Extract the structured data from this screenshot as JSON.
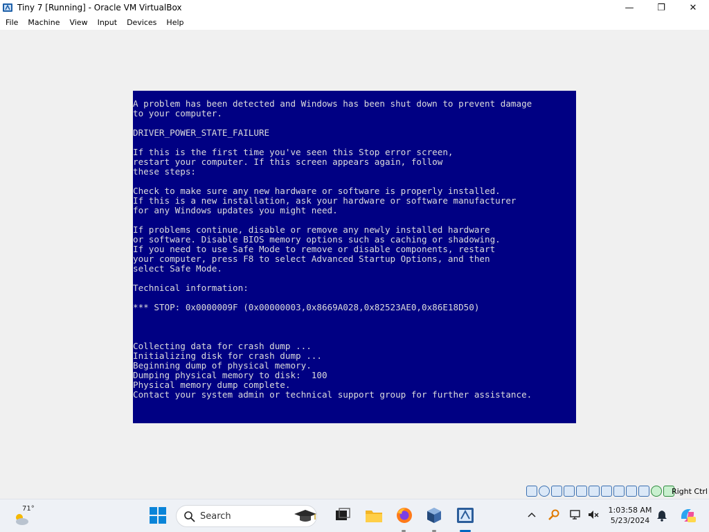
{
  "window": {
    "title": "Tiny 7 [Running] - Oracle VM VirtualBox",
    "minimize_glyph": "—",
    "maximize_glyph": "❐",
    "close_glyph": "✕"
  },
  "menu": {
    "items": [
      {
        "label": "File"
      },
      {
        "label": "Machine"
      },
      {
        "label": "View"
      },
      {
        "label": "Input"
      },
      {
        "label": "Devices"
      },
      {
        "label": "Help"
      }
    ]
  },
  "bsod": {
    "background": "#000083",
    "text": "A problem has been detected and Windows has been shut down to prevent damage\nto your computer.\n\nDRIVER_POWER_STATE_FAILURE\n\nIf this is the first time you've seen this Stop error screen,\nrestart your computer. If this screen appears again, follow\nthese steps:\n\nCheck to make sure any new hardware or software is properly installed.\nIf this is a new installation, ask your hardware or software manufacturer\nfor any Windows updates you might need.\n\nIf problems continue, disable or remove any newly installed hardware\nor software. Disable BIOS memory options such as caching or shadowing.\nIf you need to use Safe Mode to remove or disable components, restart\nyour computer, press F8 to select Advanced Startup Options, and then\nselect Safe Mode.\n\nTechnical information:\n\n*** STOP: 0x0000009F (0x00000003,0x8669A028,0x82523AE0,0x86E18D50)\n\n\n\nCollecting data for crash dump ...\nInitializing disk for crash dump ...\nBeginning dump of physical memory.\nDumping physical memory to disk:  100\nPhysical memory dump complete.\nContact your system admin or technical support group for further assistance."
  },
  "statusbar": {
    "host_key": "Right Ctrl",
    "icons": [
      "hard-disk-icon",
      "optical-drive-icon",
      "audio-icon",
      "network-icon",
      "usb-icon",
      "shared-folders-icon",
      "display-icon",
      "video-capture-icon",
      "recording-icon",
      "cpu-icon",
      "guest-additions-icon",
      "mouse-integration-icon"
    ]
  },
  "taskbar": {
    "weather_temp": "71°",
    "search_placeholder": "Search",
    "time": "1:03:58 AM",
    "date": "5/23/2024"
  },
  "colors": {
    "accent": "#0067c0",
    "bsod_text": "#dcdcdc"
  }
}
